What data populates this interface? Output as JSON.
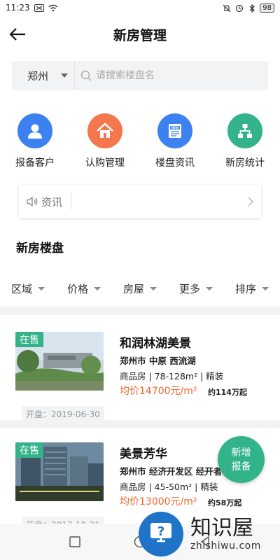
{
  "status_bar": {
    "time": "11:23",
    "battery": "98"
  },
  "header": {
    "title": "新房管理"
  },
  "search": {
    "city": "郑州",
    "placeholder": "请搜索楼盘名"
  },
  "actions": [
    {
      "label": "报备客户",
      "icon": "user-icon",
      "color": "#3b82f0"
    },
    {
      "label": "认购管理",
      "icon": "house-icon",
      "color": "#f5774e"
    },
    {
      "label": "楼盘资讯",
      "icon": "news-icon",
      "color": "#3b82f0"
    },
    {
      "label": "新房统计",
      "icon": "hierarchy-icon",
      "color": "#33b38a"
    }
  ],
  "news": {
    "label": "资讯"
  },
  "section_title": "新房楼盘",
  "filters": [
    "区域",
    "价格",
    "房屋",
    "更多",
    "排序"
  ],
  "listings": [
    {
      "status": "在售",
      "name": "和润林湖美景",
      "location": "郑州市 中原 西流湖",
      "type": "商品房 | 78-128m² | 精装",
      "avg_price": "均价14700元/m²",
      "total": "约114万起",
      "opening": "开盘：2019-06-30"
    },
    {
      "status": "在售",
      "name": "美景芳华",
      "location": "郑州市 经济开发区 经开者",
      "type": "商品房 | 45-50m² | 精装",
      "avg_price": "均价13000元/m²",
      "total": "约58万起",
      "opening": "开盘：2017-10-21"
    }
  ],
  "fab": {
    "line1": "新增",
    "line2": "报备"
  },
  "watermark": {
    "cn": "知识屋",
    "en": "zhishiwu.com"
  },
  "colors": {
    "accent_green": "#33b38a",
    "price_orange": "#f2662d",
    "blue": "#3b82f0",
    "orange": "#f5774e"
  }
}
